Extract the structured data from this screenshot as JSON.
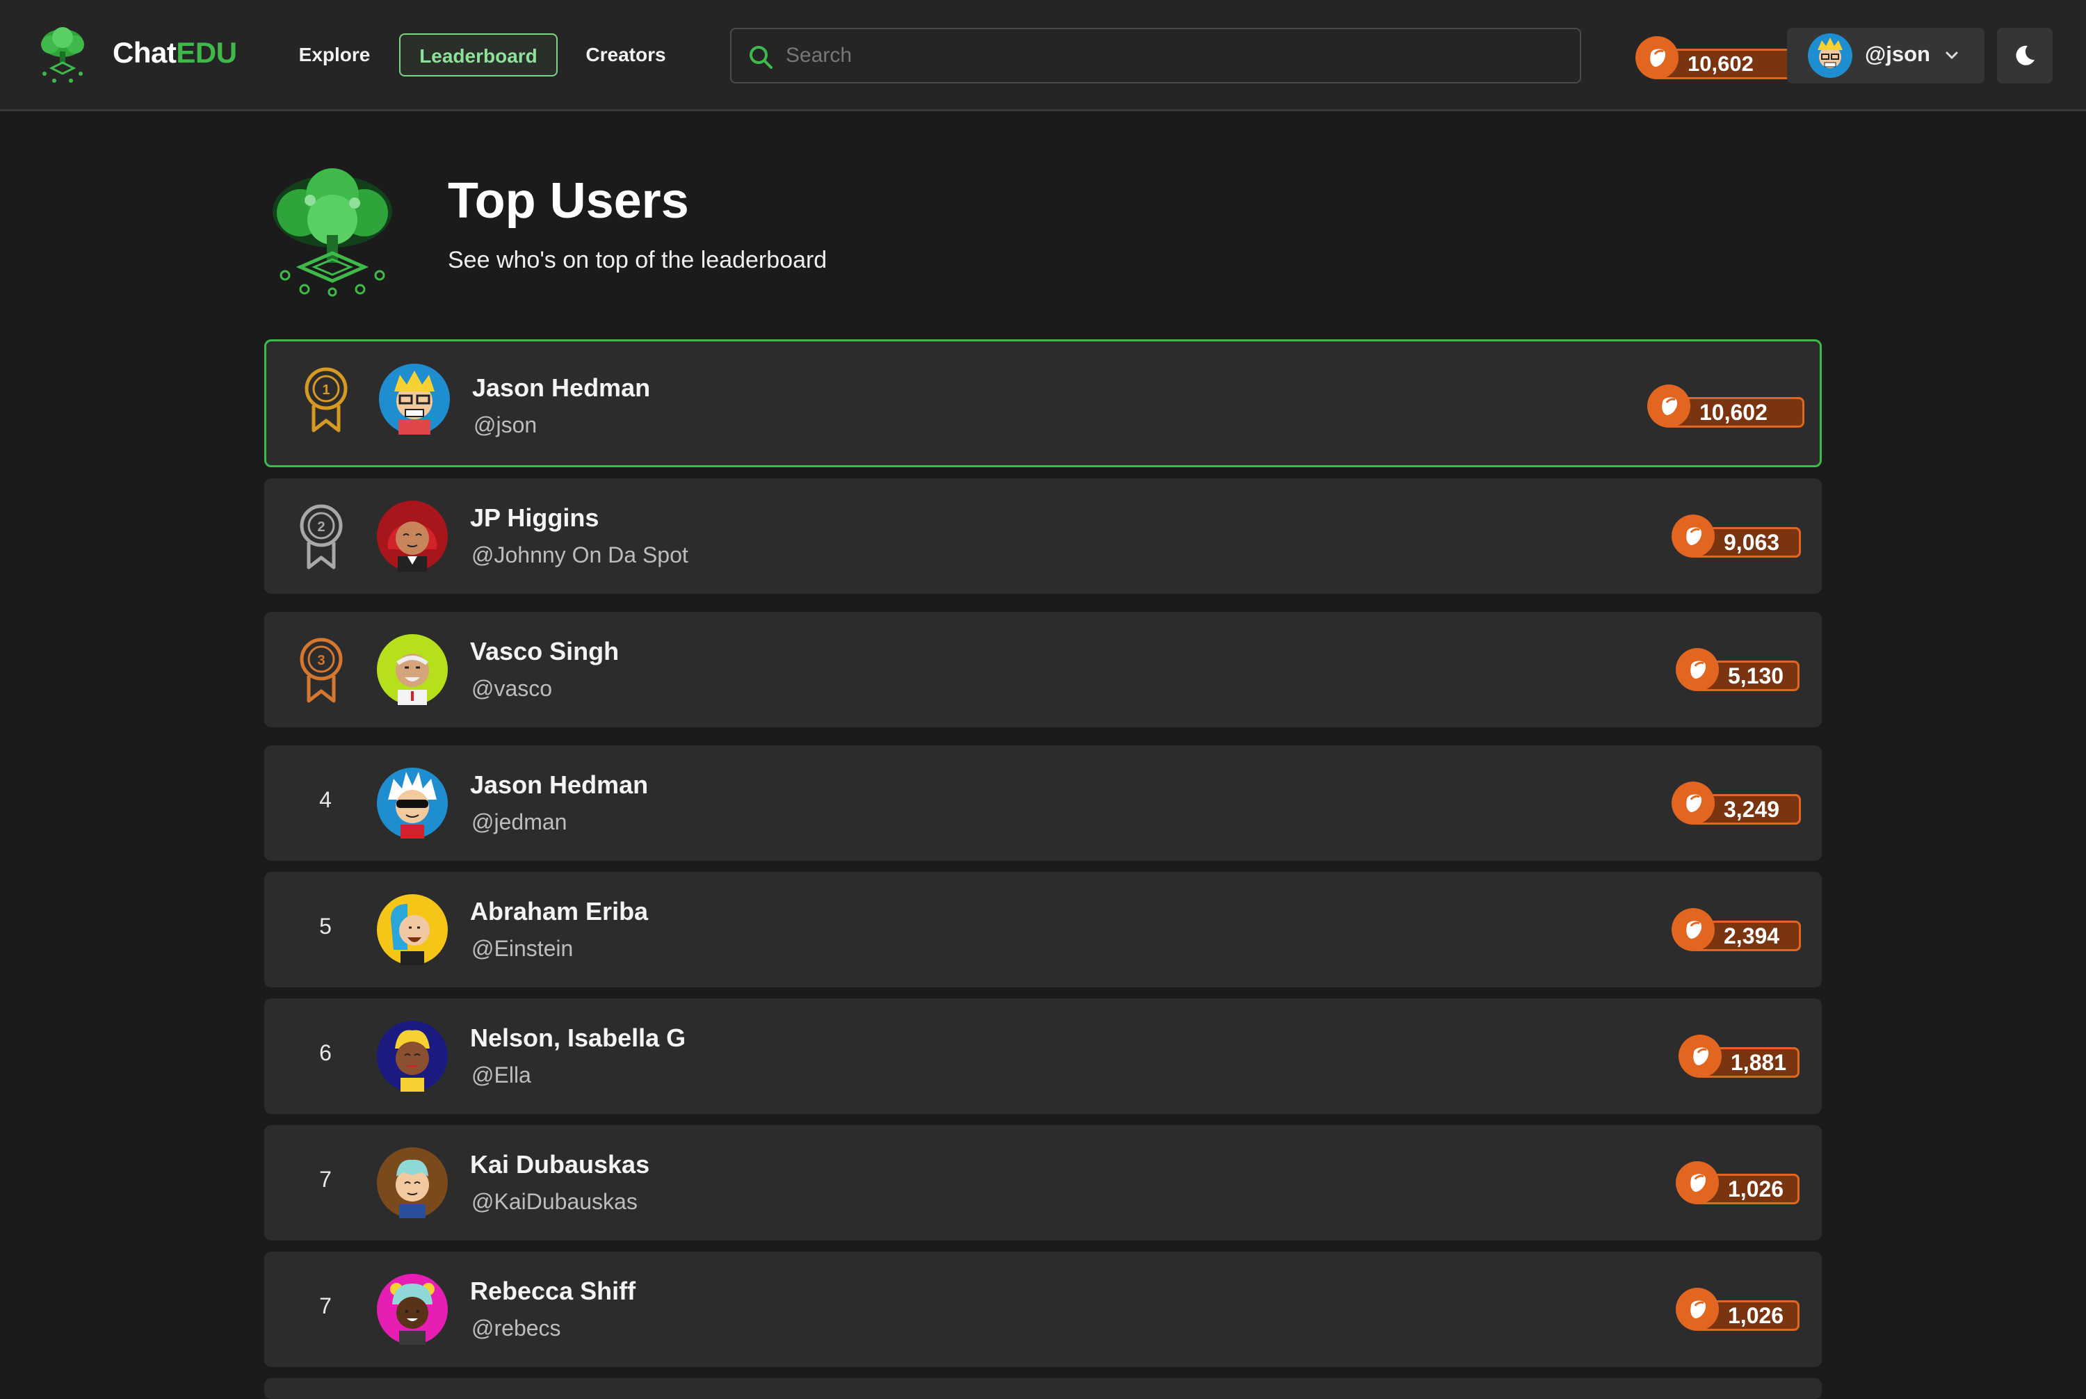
{
  "app": {
    "brand_prefix": "Chat",
    "brand_suffix": "EDU",
    "accent_color": "#3fba4a",
    "points_color": "#e2661f"
  },
  "nav": {
    "links": [
      "Explore",
      "Leaderboard",
      "Creators"
    ],
    "active": "Leaderboard",
    "search_placeholder": "Search",
    "points": "10,602",
    "username": "@json",
    "theme_icon": "moon-icon"
  },
  "page": {
    "title": "Top Users",
    "subtitle": "See who's on top of the leaderboard"
  },
  "leaderboard": [
    {
      "rank": "1",
      "medal": "gold-medal-icon",
      "name": "Jason Hedman",
      "handle": "@json",
      "points": "10,602"
    },
    {
      "rank": "2",
      "medal": "silver-medal-icon",
      "name": "JP Higgins",
      "handle": "@Johnny On Da Spot",
      "points": "9,063"
    },
    {
      "rank": "3",
      "medal": "bronze-medal-icon",
      "name": "Vasco Singh",
      "handle": "@vasco",
      "points": "5,130"
    },
    {
      "rank": "4",
      "name": "Jason Hedman",
      "handle": "@jedman",
      "points": "3,249"
    },
    {
      "rank": "5",
      "name": "Abraham Eriba",
      "handle": "@Einstein",
      "points": "2,394"
    },
    {
      "rank": "6",
      "name": "Nelson, Isabella G",
      "handle": "@Ella",
      "points": "1,881"
    },
    {
      "rank": "7",
      "name": "Kai Dubauskas",
      "handle": "@KaiDubauskas",
      "points": "1,026"
    },
    {
      "rank": "7",
      "name": "Rebecca Shiff",
      "handle": "@rebecs",
      "points": "1,026"
    }
  ]
}
